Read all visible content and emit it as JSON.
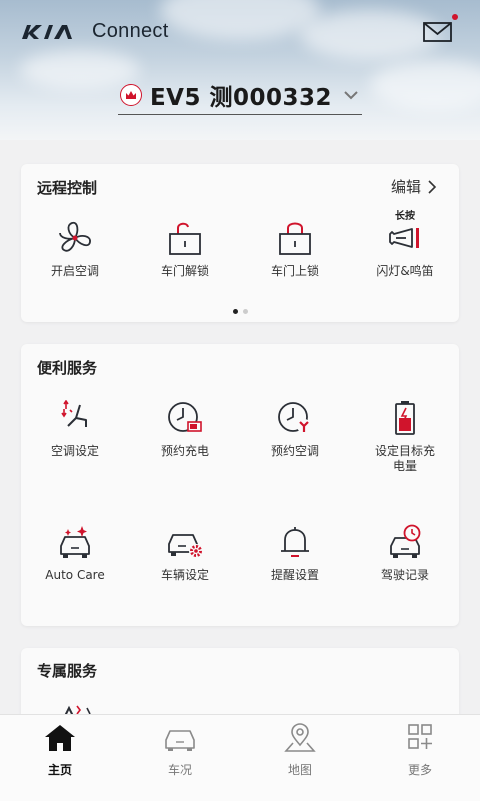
{
  "header": {
    "brand_text": "Connect",
    "car_name": "EV5 测000332"
  },
  "remote_control": {
    "title": "远程控制",
    "edit_label": "编辑",
    "items": [
      {
        "label": "开启空调",
        "icon": "fan-icon"
      },
      {
        "label": "车门解锁",
        "icon": "unlock-icon"
      },
      {
        "label": "车门上锁",
        "icon": "lock-icon"
      },
      {
        "label": "闪灯&鸣笛",
        "icon": "horn-icon",
        "hint": "长按"
      }
    ],
    "page_count": 2,
    "active_page": 1
  },
  "convenience": {
    "title": "便利服务",
    "items": [
      {
        "label": "空调设定",
        "icon": "climate-seat-icon"
      },
      {
        "label": "预约充电",
        "icon": "clock-battery-icon"
      },
      {
        "label": "预约空调",
        "icon": "clock-fan-icon"
      },
      {
        "label": "设定目标充电量",
        "icon": "battery-charge-icon"
      },
      {
        "label": "Auto Care",
        "icon": "car-sparkle-icon"
      },
      {
        "label": "车辆设定",
        "icon": "car-gear-icon"
      },
      {
        "label": "提醒设置",
        "icon": "bell-icon"
      },
      {
        "label": "驾驶记录",
        "icon": "car-clock-icon"
      }
    ]
  },
  "exclusive": {
    "title": "专属服务"
  },
  "tabbar": {
    "tabs": [
      {
        "label": "主页",
        "icon": "home-icon",
        "active": true
      },
      {
        "label": "车况",
        "icon": "car-icon",
        "active": false
      },
      {
        "label": "地图",
        "icon": "map-pin-icon",
        "active": false
      },
      {
        "label": "更多",
        "icon": "grid-plus-icon",
        "active": false
      }
    ]
  },
  "colors": {
    "accent_red": "#d0142c",
    "icon_dark": "#2b2f36"
  }
}
